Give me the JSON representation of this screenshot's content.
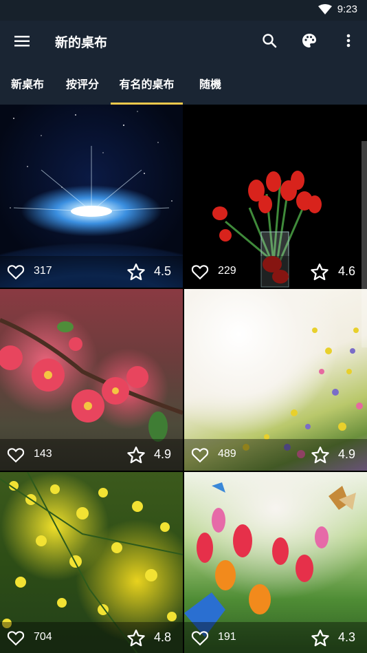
{
  "status_bar": {
    "time": "9:23"
  },
  "toolbar": {
    "title": "新的桌布",
    "menu_icon": "hamburger-menu-icon",
    "search_icon": "search-icon",
    "palette_icon": "palette-icon",
    "overflow_icon": "more-vert-icon"
  },
  "tabs": [
    {
      "label": "新桌布",
      "active": false
    },
    {
      "label": "按评分",
      "active": false
    },
    {
      "label": "有名的桌布",
      "active": true
    },
    {
      "label": "随機",
      "active": false
    }
  ],
  "accent_color": "#f2c94c",
  "wallpapers": [
    {
      "likes": "317",
      "rating": "4.5"
    },
    {
      "likes": "229",
      "rating": "4.6"
    },
    {
      "likes": "143",
      "rating": "4.9"
    },
    {
      "likes": "489",
      "rating": "4.9"
    },
    {
      "likes": "704",
      "rating": "4.8"
    },
    {
      "likes": "191",
      "rating": "4.3"
    }
  ]
}
